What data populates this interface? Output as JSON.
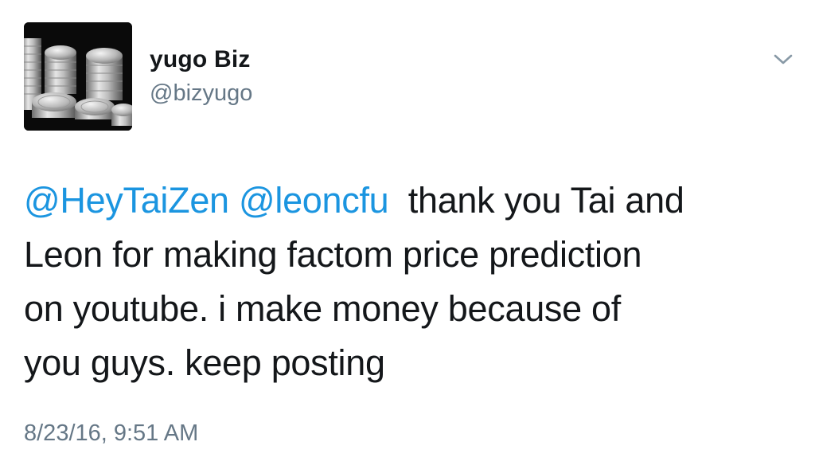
{
  "tweet": {
    "author": {
      "display_name": "yugo Biz",
      "handle": "@bizyugo",
      "avatar_icon": "silver-coins-avatar"
    },
    "menu_icon": "chevron-down-icon",
    "text": {
      "mention_1": "@HeyTaiZen",
      "mention_2": "@leoncfu",
      "line_1_rest": "thank you Tai and",
      "line_2": "Leon for making factom price prediction",
      "line_3": "on youtube. i make money because of",
      "line_4": "you guys. keep posting"
    },
    "timestamp": "8/23/16, 9:51 AM"
  },
  "colors": {
    "mention": "#1b95e0",
    "secondary_text": "#657786",
    "primary_text": "#14171a",
    "background": "#ffffff"
  }
}
